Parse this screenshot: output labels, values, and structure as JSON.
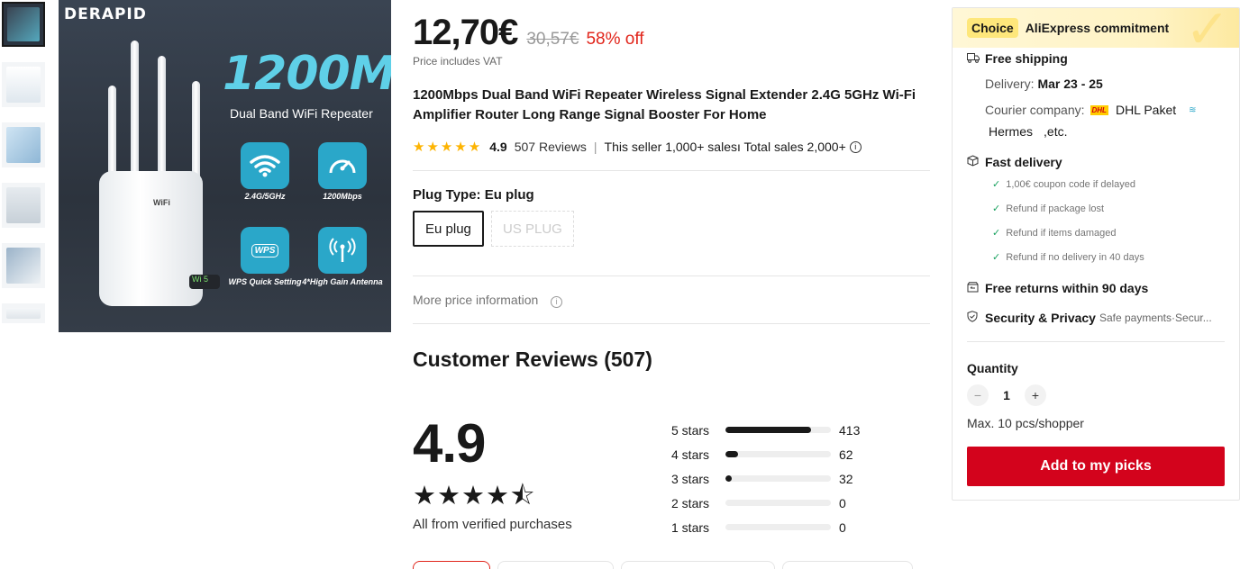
{
  "gallery": {
    "thumb_count": 6,
    "main": {
      "brand": "DERAPID",
      "model": "1200M",
      "subtitle": "Dual Band WiFi Repeater",
      "features": [
        {
          "icon": "wifi-icon",
          "label": "2.4G/5GHz"
        },
        {
          "icon": "speed-gauge-icon",
          "label": "1200Mbps"
        },
        {
          "icon": "wps-icon",
          "label": "WPS Quick Setting",
          "badge": "WPS"
        },
        {
          "icon": "antenna-icon",
          "label": "4*High Gain Antenna"
        }
      ],
      "device_label": "WiFi",
      "led_text": "5"
    }
  },
  "price": {
    "current": "12,70€",
    "original": "30,57€",
    "discount": "58% off",
    "vat_note": "Price includes VAT"
  },
  "product": {
    "title": "1200Mbps Dual Band WiFi Repeater Wireless Signal Extender 2.4G 5GHz Wi-Fi Amplifier Router Long Range Signal Booster For Home",
    "rating": "4.9",
    "reviews": "507 Reviews",
    "sales": "This seller 1,000+ salesı Total sales 2,000+"
  },
  "plug": {
    "label": "Plug Type: Eu plug",
    "options": [
      "Eu plug",
      "US PLUG"
    ]
  },
  "more_price": "More price information",
  "customer_reviews": {
    "title": "Customer Reviews (507)",
    "score": "4.9",
    "stars_value": 4.5,
    "verified": "All from verified purchases",
    "distribution": [
      {
        "label": "5 stars",
        "count": "413",
        "fraction": 0.814
      },
      {
        "label": "4 stars",
        "count": "62",
        "fraction": 0.122
      },
      {
        "label": "3 stars",
        "count": "32",
        "fraction": 0.063
      },
      {
        "label": "2 stars",
        "count": "0",
        "fraction": 0
      },
      {
        "label": "1 stars",
        "count": "0",
        "fraction": 0
      }
    ]
  },
  "panel": {
    "choice": "Choice",
    "commitment": "AliExpress commitment",
    "free_shipping": "Free shipping",
    "delivery_label": "Delivery:",
    "delivery_date": "Mar 23 - 25",
    "courier_label": "Courier company:",
    "courier_dhl_logo": "DHL",
    "courier_name": "DHL Paket",
    "courier_more": "Hermes",
    "courier_etc": ",etc.",
    "fast_delivery": "Fast delivery",
    "guarantees": [
      "1,00€ coupon code if delayed",
      "Refund if package lost",
      "Refund if items damaged",
      "Refund if no delivery in 40 days"
    ],
    "free_returns": "Free returns within 90 days",
    "security": "Security & Privacy",
    "security_detail": "Safe payments·Secur...",
    "quantity_label": "Quantity",
    "quantity": "1",
    "max": "Max. 10 pcs/shopper",
    "add_button": "Add to my picks"
  }
}
